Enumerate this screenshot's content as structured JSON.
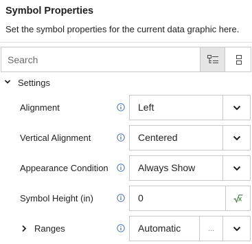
{
  "header": {
    "title": "Symbol Properties",
    "description": "Set the symbol properties for the current data graphic here."
  },
  "search": {
    "placeholder": "Search",
    "value": "",
    "categorized_icon": "categorized-view-icon",
    "alphabetical_icon": "alphabetical-view-icon"
  },
  "section": {
    "label": "Settings",
    "expanded": true
  },
  "properties": [
    {
      "label": "Alignment",
      "value": "Left",
      "control": "dropdown"
    },
    {
      "label": "Vertical Alignment",
      "value": "Centered",
      "control": "dropdown"
    },
    {
      "label": "Appearance Condition",
      "value": "Always Show",
      "control": "dropdown"
    },
    {
      "label": "Symbol Height (in)",
      "value": "0",
      "control": "formula"
    },
    {
      "label": "Ranges",
      "value": "Automatic",
      "control": "dropdown-with-ellipsis",
      "ellipsis": "..."
    }
  ],
  "colors": {
    "accent": "#3c7a3a",
    "info_icon": "#4a6da7"
  }
}
